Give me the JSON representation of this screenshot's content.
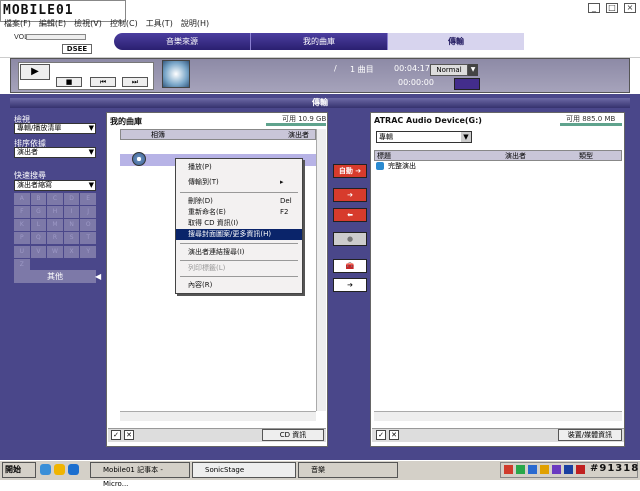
{
  "logo": "MOBILE01",
  "menu": [
    "檔案(F)",
    "編輯(E)",
    "檢視(V)",
    "控制(C)",
    "工具(T)",
    "說明(H)"
  ],
  "volume_label": "VOL",
  "dsee": "DSEE",
  "nav": [
    "音樂來源",
    "我的曲庫",
    "傳輸"
  ],
  "player": {
    "slash": "/",
    "track": "1 曲目",
    "time_total": "00:04:17",
    "time_current": "00:00:00",
    "mode": "Normal"
  },
  "main_header": "傳輸",
  "sidebar": {
    "view_label": "檢視",
    "view_value": "專輯/播放清單",
    "sort_label": "排序依據",
    "sort_value": "演出者",
    "search_label": "快速搜尋",
    "search_value": "演出者縮寫",
    "letters": [
      "A",
      "B",
      "C",
      "D",
      "E",
      "F",
      "G",
      "H",
      "I",
      "J",
      "K",
      "L",
      "M",
      "N",
      "O",
      "P",
      "Q",
      "R",
      "S",
      "T",
      "U",
      "V",
      "W",
      "X",
      "Y",
      "Z"
    ],
    "other": "其他"
  },
  "library": {
    "title": "我的曲庫",
    "capacity": "可用 10.9 GB",
    "col_album": "相簿",
    "col_artist": "演出者",
    "cd_info": "CD 資訊"
  },
  "context_menu": {
    "items": [
      {
        "label": "播放(P)",
        "shortcut": ""
      },
      {
        "label": "傳輸到(T)",
        "shortcut": "▸"
      },
      {
        "label": "刪除(D)",
        "shortcut": "Del"
      },
      {
        "label": "重新命名(E)",
        "shortcut": "F2"
      },
      {
        "label": "取得 CD 資訊(I)",
        "shortcut": ""
      },
      {
        "label": "搜尋封面圖案/更多資訊(H)",
        "shortcut": ""
      },
      {
        "label": "演出者連結搜尋(I)",
        "shortcut": ""
      },
      {
        "label": "列印標籤(L)",
        "shortcut": ""
      },
      {
        "label": "內容(R)",
        "shortcut": ""
      }
    ]
  },
  "mid_buttons": {
    "auto": "自動"
  },
  "device": {
    "title": "ATRAC Audio Device(G:)",
    "capacity": "可用 885.0 MB",
    "dropdown": "專輯",
    "col_title": "標題",
    "col_artist": "演出者",
    "col_type": "類型",
    "row": "完整演出",
    "info": "裝置/媒體資訊"
  },
  "taskbar": {
    "start": "開始",
    "tasks": [
      "Mobile01 記事本 - Micro...",
      "SonicStage",
      "音樂"
    ],
    "watermark": "#91318"
  },
  "colors": {
    "accent": "#4a478a",
    "nav": "#2a1f70",
    "highlight": "#0a246a",
    "transfer_red": "#d73b2c"
  }
}
